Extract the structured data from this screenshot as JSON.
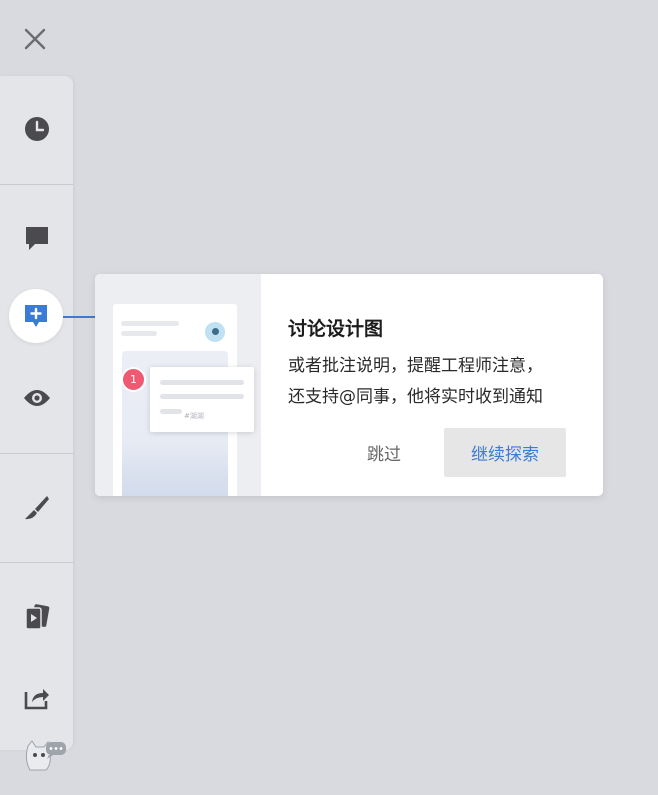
{
  "window": {
    "close_icon": "close-icon"
  },
  "sidebar": {
    "items": [
      {
        "icon": "clock-icon"
      },
      {
        "icon": "comment-icon"
      },
      {
        "icon": "add-comment-icon",
        "active": true
      },
      {
        "icon": "eye-icon"
      },
      {
        "icon": "brush-icon"
      },
      {
        "icon": "play-cards-icon"
      },
      {
        "icon": "share-icon"
      }
    ]
  },
  "guide": {
    "title": "讨论设计图",
    "line1": "或者批注说明，提醒工程师注意，",
    "line2": "还支持@同事，他将实时收到通知",
    "skip_label": "跳过",
    "continue_label": "继续探索",
    "illustration": {
      "badge_count": "1",
      "tag_text": "#湖湖"
    }
  },
  "mascot": {
    "icon": "mascot-chat-icon"
  },
  "colors": {
    "accent": "#3a7bd5",
    "badge": "#ef5a72",
    "background": "#d9dadf"
  }
}
